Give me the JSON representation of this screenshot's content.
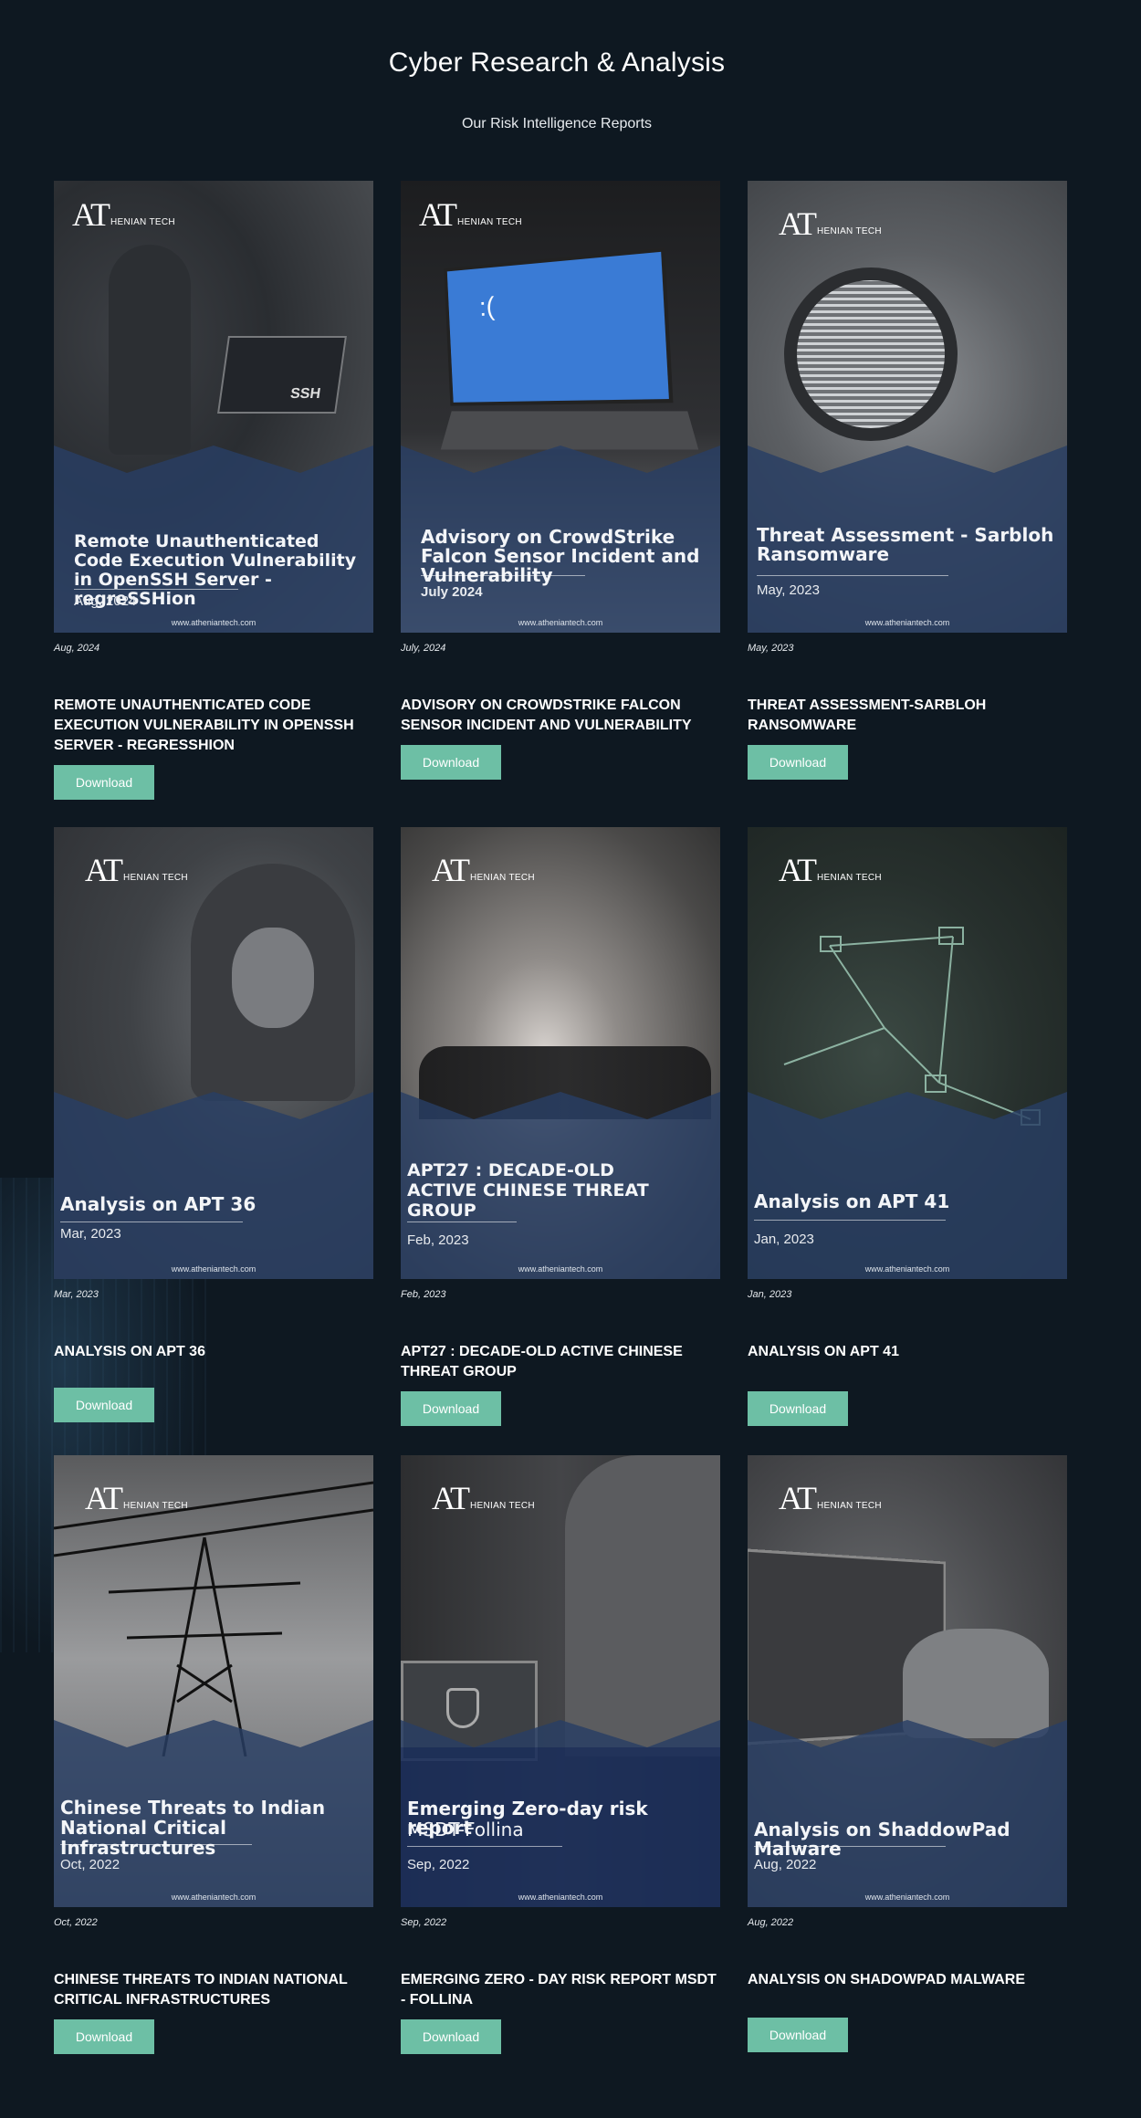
{
  "header": {
    "title": "Cyber Research & Analysis",
    "subtitle": "Our Risk Intelligence Reports"
  },
  "reports": [
    {
      "cover": {
        "logo_mark": "AT",
        "logo_word": "HENIAN TECH",
        "title": "Remote Unauthenticated Code Execution Vulnerability in OpenSSH Server - regreSSHion",
        "date": "Aug, 2024",
        "url": "www.atheniantech.com",
        "screen_text": "SSH"
      },
      "date": "Aug, 2024",
      "title": "REMOTE UNAUTHENTICATED CODE EXECUTION VULNERABILITY IN OPENSSH SERVER - REGRESSHION",
      "button": "Download"
    },
    {
      "cover": {
        "logo_mark": "AT",
        "logo_word": "HENIAN TECH",
        "title": "Advisory on CrowdStrike Falcon Sensor Incident and Vulnerability",
        "date": "July 2024",
        "url": "www.atheniantech.com",
        "screen_text": ":("
      },
      "date": "July, 2024",
      "title": "ADVISORY ON CROWDSTRIKE FALCON SENSOR INCIDENT AND VULNERABILITY",
      "button": "Download"
    },
    {
      "cover": {
        "logo_mark": "AT",
        "logo_word": "HENIAN TECH",
        "title": "Threat Assessment - Sarbloh Ransomware",
        "date": "May, 2023",
        "url": "www.atheniantech.com"
      },
      "date": "May, 2023",
      "title": "THREAT ASSESSMENT-SARBLOH RANSOMWARE",
      "button": "Download"
    },
    {
      "cover": {
        "logo_mark": "AT",
        "logo_word": "HENIAN TECH",
        "title": "Analysis on APT 36",
        "date": "Mar, 2023",
        "url": "www.atheniantech.com"
      },
      "date": "Mar, 2023",
      "title": "ANALYSIS ON APT 36",
      "button": "Download"
    },
    {
      "cover": {
        "logo_mark": "AT",
        "logo_word": "HENIAN TECH",
        "title": "APT27 : DECADE-OLD ACTIVE CHINESE THREAT GROUP",
        "date": "Feb, 2023",
        "url": "www.atheniantech.com"
      },
      "date": "Feb, 2023",
      "title": "APT27 : DECADE-OLD ACTIVE CHINESE THREAT GROUP",
      "button": "Download"
    },
    {
      "cover": {
        "logo_mark": "AT",
        "logo_word": "HENIAN TECH",
        "title": "Analysis on APT 41",
        "date": "Jan, 2023",
        "url": "www.atheniantech.com"
      },
      "date": "Jan, 2023",
      "title": "ANALYSIS ON APT 41",
      "button": "Download"
    },
    {
      "cover": {
        "logo_mark": "AT",
        "logo_word": "HENIAN TECH",
        "title": "Chinese Threats to Indian National Critical Infrastructures",
        "date": "Oct, 2022",
        "url": "www.atheniantech.com"
      },
      "date": "Oct, 2022",
      "title": "CHINESE THREATS TO INDIAN NATIONAL CRITICAL INFRASTRUCTURES",
      "button": "Download"
    },
    {
      "cover": {
        "logo_mark": "AT",
        "logo_word": "HENIAN TECH",
        "title": "Emerging Zero-day risk report",
        "title2": "MSDT-Follina",
        "date": "Sep, 2022",
        "url": "www.atheniantech.com"
      },
      "date": "Sep, 2022",
      "title": "EMERGING ZERO - DAY RISK REPORT MSDT - FOLLINA",
      "button": "Download"
    },
    {
      "cover": {
        "logo_mark": "AT",
        "logo_word": "HENIAN TECH",
        "title": "Analysis on ShaddowPad Malware",
        "date": "Aug, 2022",
        "url": "www.atheniantech.com"
      },
      "date": "Aug, 2022",
      "title": "ANALYSIS ON SHADOWPAD MALWARE",
      "button": "Download"
    }
  ],
  "colors": {
    "background": "#0e1821",
    "button": "#6dbfa5",
    "band": "#283e64"
  }
}
